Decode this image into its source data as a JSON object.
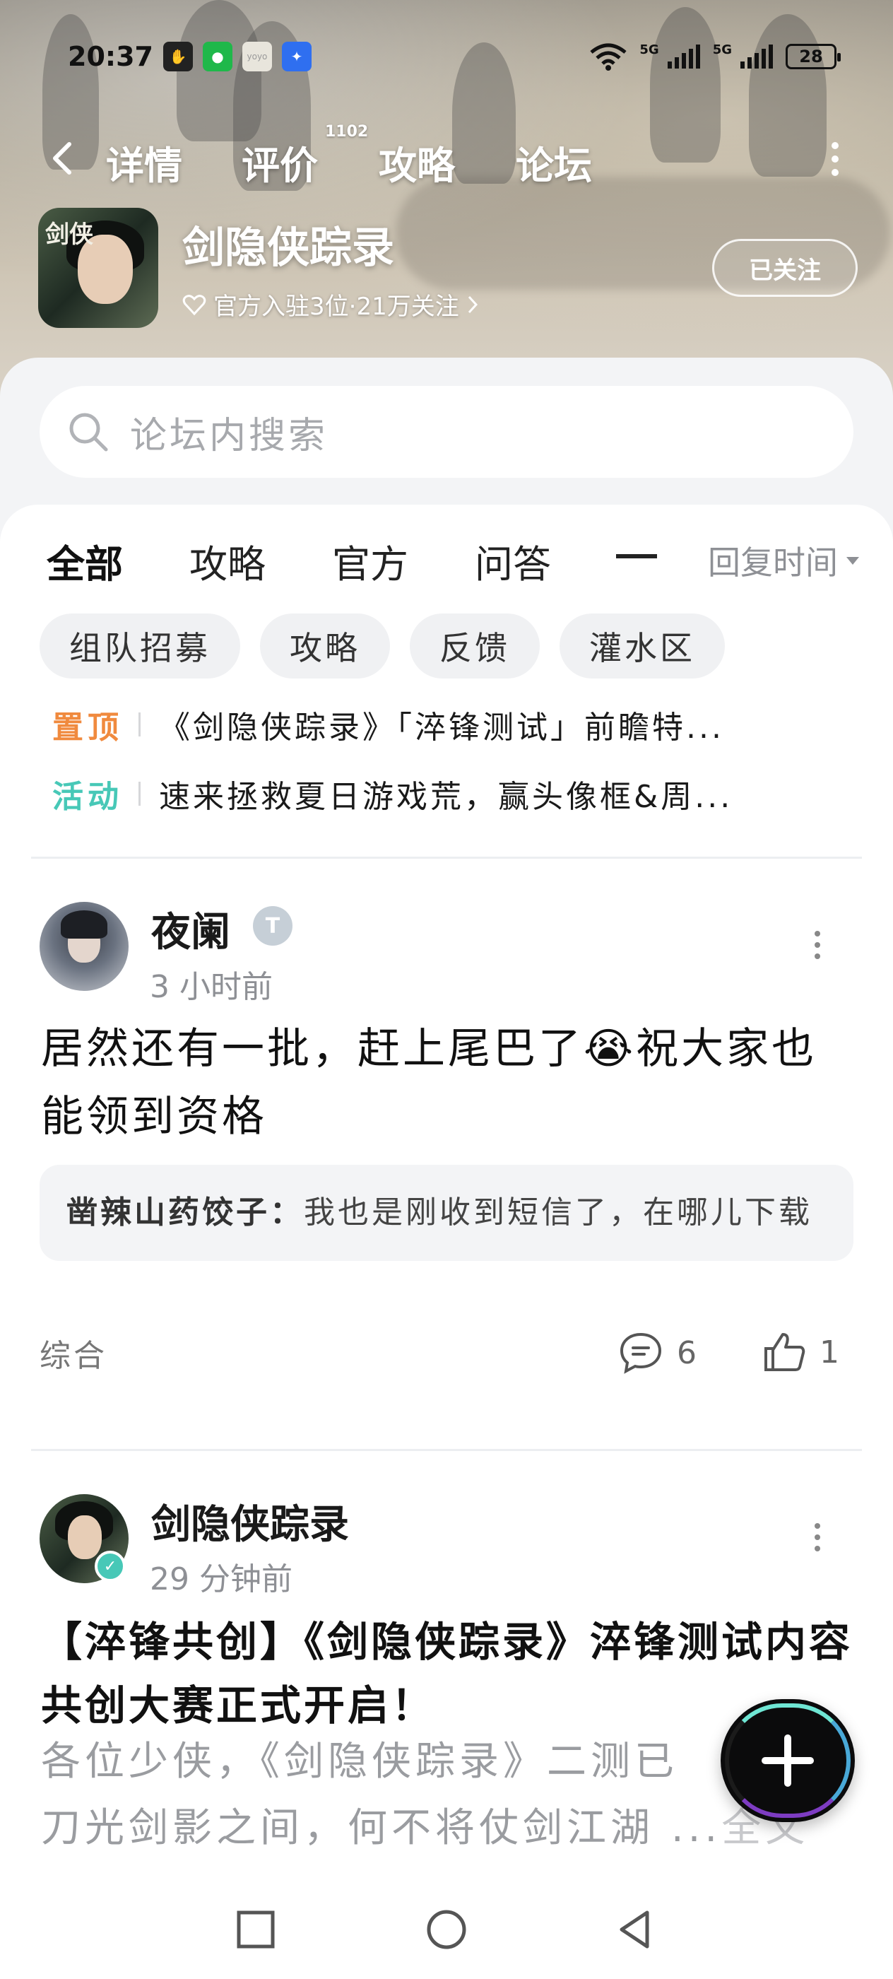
{
  "status_bar": {
    "time": "20:37",
    "network_1": "5G",
    "network_2": "5G",
    "battery": "28"
  },
  "nav": {
    "tabs": [
      "详情",
      "评价",
      "攻略",
      "论坛"
    ],
    "active_tab": "论坛",
    "review_badge": "1102"
  },
  "game": {
    "title": "剑隐侠踪录",
    "meta": "官方入驻3位·21万关注",
    "follow_label": "已关注",
    "icon_seal": "剑侠"
  },
  "search": {
    "placeholder": "论坛内搜索"
  },
  "categories": {
    "tabs": [
      "全部",
      "攻略",
      "官方",
      "问答"
    ],
    "active": "全部",
    "sort_label": "回复时间"
  },
  "chips": [
    "组队招募",
    "攻略",
    "反馈",
    "灌水区"
  ],
  "notices": [
    {
      "tag": "置顶",
      "text": "《剑隐侠踪录》「淬锋测试」前瞻特...",
      "color": "#f08a3e"
    },
    {
      "tag": "活动",
      "text": "速来拯救夏日游戏荒，赢头像框&周...",
      "color": "#47c8b7"
    }
  ],
  "posts": [
    {
      "author": "夜阑",
      "time": "3 小时前",
      "body": "居然还有一批，赶上尾巴了😭祝大家也能领到资格",
      "reply_author": "凿辣山药饺子：",
      "reply_text": "我也是刚收到短信了，在哪儿下载",
      "tag": "综合",
      "comments": "6",
      "likes": "1"
    },
    {
      "author": "剑隐侠踪录",
      "time": "29 分钟前",
      "title": "【淬锋共创】《剑隐侠踪录》淬锋测试内容共创大赛正式开启！",
      "excerpt_line1": "各位少侠，《剑隐侠踪录》二测已",
      "excerpt_line2": "刀光剑影之间，何不将仗剑江湖",
      "ellipsis": "...",
      "full_text_label": "全文"
    }
  ],
  "colors": {
    "accent": "#53d7c3",
    "pin": "#f08a3e",
    "event": "#47c8b7"
  }
}
